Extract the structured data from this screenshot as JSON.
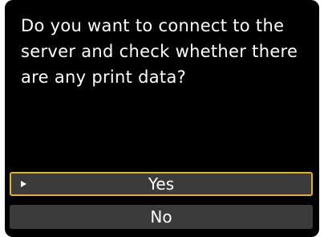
{
  "dialog": {
    "message": "Do you want to connect to the server and check whether there are any print data?",
    "options": [
      {
        "label": "Yes",
        "selected": true
      },
      {
        "label": "No",
        "selected": false
      }
    ],
    "selection_icon": "right-triangle-cursor"
  },
  "colors": {
    "screen_background": "#000000",
    "text": "#ffffff",
    "option_background": "#3b3b3b",
    "selection_border": "#e3b21c"
  }
}
